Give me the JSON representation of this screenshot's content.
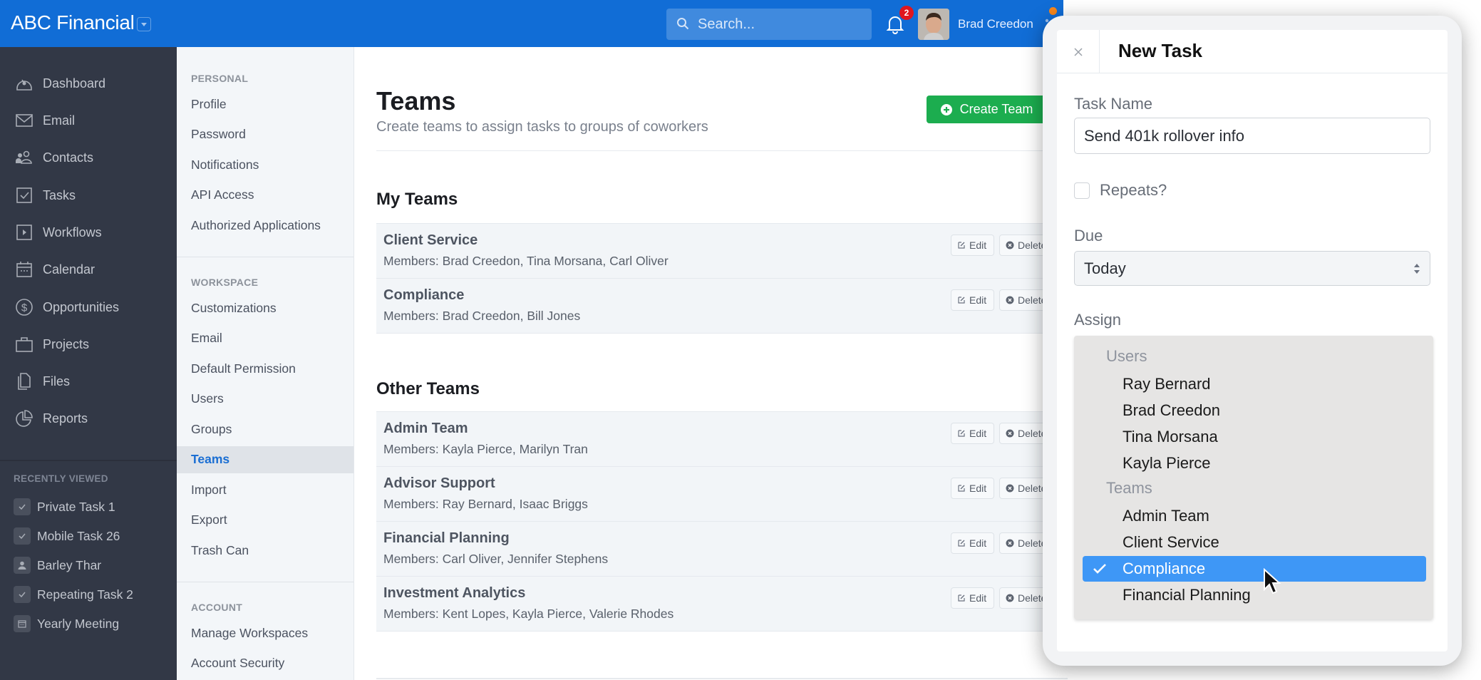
{
  "header": {
    "brand": "ABC Financial",
    "search_placeholder": "Search...",
    "notification_count": "2",
    "user_name": "Brad Creedon"
  },
  "sidebar": {
    "items": [
      {
        "label": "Dashboard",
        "icon": "dashboard-icon"
      },
      {
        "label": "Email",
        "icon": "envelope-icon"
      },
      {
        "label": "Contacts",
        "icon": "contacts-icon"
      },
      {
        "label": "Tasks",
        "icon": "checkbox-icon"
      },
      {
        "label": "Workflows",
        "icon": "play-icon"
      },
      {
        "label": "Calendar",
        "icon": "calendar-icon"
      },
      {
        "label": "Opportunities",
        "icon": "dollar-icon"
      },
      {
        "label": "Projects",
        "icon": "briefcase-icon"
      },
      {
        "label": "Files",
        "icon": "files-icon"
      },
      {
        "label": "Reports",
        "icon": "pie-chart-icon"
      }
    ],
    "recent_title": "RECENTLY VIEWED",
    "recent": [
      {
        "label": "Private Task 1",
        "icon": "check-icon"
      },
      {
        "label": "Mobile Task 26",
        "icon": "check-icon"
      },
      {
        "label": "Barley Thar",
        "icon": "person-icon"
      },
      {
        "label": "Repeating Task 2",
        "icon": "check-icon"
      },
      {
        "label": "Yearly Meeting",
        "icon": "calendar-icon"
      }
    ]
  },
  "settings": {
    "personal_heading": "PERSONAL",
    "personal": [
      "Profile",
      "Password",
      "Notifications",
      "API Access",
      "Authorized Applications"
    ],
    "workspace_heading": "WORKSPACE",
    "workspace": [
      "Customizations",
      "Email",
      "Default Permission",
      "Users",
      "Groups",
      "Teams",
      "Import",
      "Export",
      "Trash Can"
    ],
    "active": "Teams",
    "account_heading": "ACCOUNT",
    "account": [
      "Manage Workspaces",
      "Account Security"
    ]
  },
  "main": {
    "title": "Teams",
    "subtitle": "Create teams to assign tasks to groups of coworkers",
    "create_label": "Create Team",
    "edit_label": "Edit",
    "delete_label": "Delete",
    "my_teams_title": "My Teams",
    "my_teams": [
      {
        "name": "Client Service",
        "members": "Members: Brad Creedon, Tina Morsana, Carl Oliver"
      },
      {
        "name": "Compliance",
        "members": "Members: Brad Creedon, Bill Jones"
      }
    ],
    "other_teams_title": "Other Teams",
    "other_teams": [
      {
        "name": "Admin Team",
        "members": "Members: Kayla Pierce, Marilyn Tran"
      },
      {
        "name": "Advisor Support",
        "members": "Members: Ray Bernard, Isaac Briggs"
      },
      {
        "name": "Financial Planning",
        "members": "Members: Carl Oliver, Jennifer Stephens"
      },
      {
        "name": "Investment Analytics",
        "members": "Members: Kent Lopes, Kayla Pierce, Valerie Rhodes"
      }
    ]
  },
  "modal": {
    "title": "New Task",
    "task_name_label": "Task Name",
    "task_name_value": "Send 401k rollover info",
    "repeats_label": "Repeats?",
    "repeats_checked": false,
    "due_label": "Due",
    "due_value": "Today",
    "assign_label": "Assign",
    "assign_groups": [
      {
        "label": "Users",
        "options": [
          "Ray Bernard",
          "Brad Creedon",
          "Tina Morsana",
          "Kayla Pierce"
        ]
      },
      {
        "label": "Teams",
        "options": [
          "Admin Team",
          "Client Service",
          "Compliance",
          "Financial Planning"
        ]
      }
    ],
    "assign_selected": "Compliance"
  },
  "colors": {
    "header_blue": "#116dd6",
    "sidebar_dark": "#323846",
    "create_green": "#1cad4f",
    "selected_blue": "#3e97f6",
    "badge_red": "#e0161e",
    "active_link": "#1b6fd3"
  }
}
